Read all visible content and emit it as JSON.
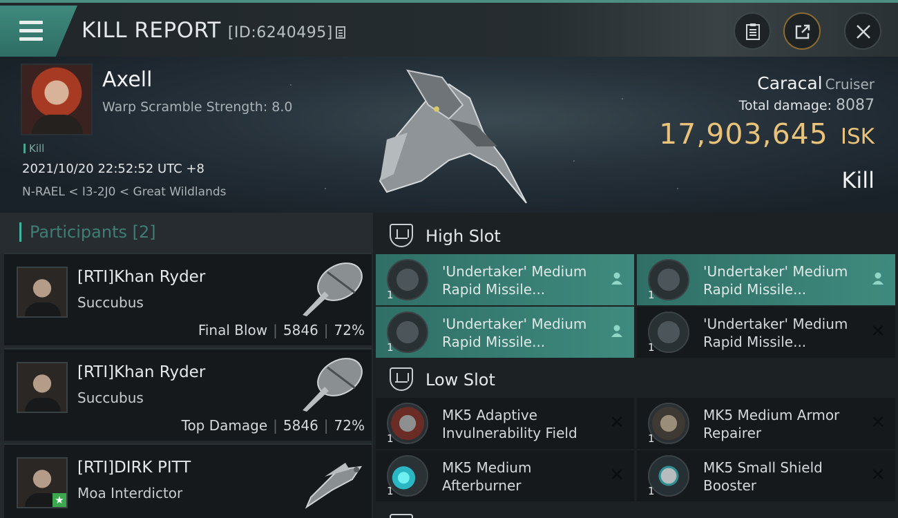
{
  "header": {
    "title": "KILL REPORT",
    "kill_id": "[ID:6240495]"
  },
  "victim": {
    "name": "Axell",
    "warp_scramble": "Warp Scramble Strength: 8.0",
    "tag": "Kill",
    "datetime": "2021/10/20 22:52:52 UTC +8",
    "location": "N-RAEL < I3-2J0 < Great Wildlands",
    "ship_name": "Caracal",
    "ship_class": "Cruiser",
    "total_damage_label": "Total damage:",
    "total_damage": "8087",
    "isk_value": "17,903,645",
    "isk_unit": "ISK",
    "outcome": "Kill"
  },
  "participants": {
    "title": "Participants [2]",
    "items": [
      {
        "name": "[RTI]Khan Ryder",
        "ship": "Succubus",
        "role": "Final Blow",
        "damage": "5846",
        "percent": "72%"
      },
      {
        "name": "[RTI]Khan Ryder",
        "ship": "Succubus",
        "role": "Top Damage",
        "damage": "5846",
        "percent": "72%"
      },
      {
        "name": "[RTI]DIRK PITT",
        "ship": "Moa Interdictor",
        "role": "",
        "damage": "",
        "percent": ""
      }
    ]
  },
  "slots": {
    "high": {
      "title": "High Slot",
      "modules": [
        {
          "line1": "'Undertaker' Medium",
          "line2": "Rapid Missile...",
          "qty": "1",
          "status": "dropped"
        },
        {
          "line1": "'Undertaker' Medium",
          "line2": "Rapid Missile...",
          "qty": "1",
          "status": "dropped"
        },
        {
          "line1": "'Undertaker' Medium",
          "line2": "Rapid Missile...",
          "qty": "1",
          "status": "dropped"
        },
        {
          "line1": "'Undertaker' Medium",
          "line2": "Rapid Missile...",
          "qty": "1",
          "status": "destroyed"
        }
      ]
    },
    "low": {
      "title": "Low Slot",
      "modules": [
        {
          "line1": "MK5 Adaptive",
          "line2": "Invulnerability Field",
          "qty": "1",
          "status": "destroyed"
        },
        {
          "line1": "MK5 Medium Armor",
          "line2": "Repairer",
          "qty": "1",
          "status": "destroyed"
        },
        {
          "line1": "MK5 Medium",
          "line2": "Afterburner",
          "qty": "1",
          "status": "destroyed"
        },
        {
          "line1": "MK5 Small Shield",
          "line2": "Booster",
          "qty": "1",
          "status": "destroyed"
        }
      ]
    }
  },
  "icons": {
    "menu": "hamburger-icon",
    "copy": "copy-icon",
    "report": "clipboard-icon",
    "share": "share-icon",
    "close": "close-icon",
    "dropped": "person-icon",
    "destroyed": "x-icon"
  },
  "colors": {
    "accent": "#3f8a7e",
    "isk": "#e9c37a",
    "participants_title": "#3f7e74"
  }
}
